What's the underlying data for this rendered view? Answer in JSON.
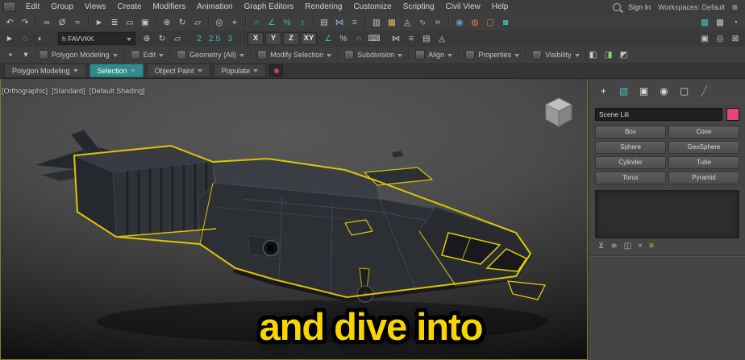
{
  "app": {
    "selection_color": "#e8cc00",
    "accent_color": "#3fbfbf"
  },
  "menubar": {
    "items": [
      "Edit",
      "Group",
      "Views",
      "Create",
      "Modifiers",
      "Animation",
      "Graph Editors",
      "Rendering",
      "Customize",
      "Scripting",
      "Civil View",
      "Help"
    ],
    "right": {
      "sign_in": "Sign In",
      "workspace": "Workspaces: Default",
      "menu_glyph": "≡"
    }
  },
  "toolbar1": {
    "icons": [
      {
        "name": "undo-icon",
        "glyph": "↶"
      },
      {
        "name": "redo-icon",
        "glyph": "↷"
      },
      {
        "name": "separator",
        "sep": true
      },
      {
        "name": "select-link-icon",
        "glyph": "∞"
      },
      {
        "name": "unlink-icon",
        "glyph": "Ø"
      },
      {
        "name": "bind-spacewarp-icon",
        "glyph": "≈"
      },
      {
        "name": "separator",
        "sep": true
      },
      {
        "name": "select-object-icon",
        "glyph": "►"
      },
      {
        "name": "select-by-name-icon",
        "glyph": "≣"
      },
      {
        "name": "rectangular-selection-icon",
        "glyph": "▭"
      },
      {
        "name": "window-crossing-icon",
        "glyph": "▣"
      },
      {
        "name": "separator",
        "sep": true
      },
      {
        "name": "select-move-icon",
        "glyph": "⊕"
      },
      {
        "name": "select-rotate-icon",
        "glyph": "↻"
      },
      {
        "name": "select-scale-icon",
        "glyph": "▱"
      },
      {
        "name": "separator",
        "sep": true
      },
      {
        "name": "use-pivot-center-icon",
        "glyph": "◎"
      },
      {
        "name": "select-manipulate-icon",
        "glyph": "⌖"
      },
      {
        "name": "separator",
        "sep": true
      },
      {
        "name": "snap-toggle-icon",
        "glyph": "∩",
        "color": "#3fbfbf"
      },
      {
        "name": "angle-snap-icon",
        "glyph": "∠",
        "color": "#3fbfbf"
      },
      {
        "name": "percent-snap-icon",
        "glyph": "%",
        "color": "#3fbfbf"
      },
      {
        "name": "spinner-snap-icon",
        "glyph": "↕",
        "color": "#3fbfbf"
      },
      {
        "name": "separator",
        "sep": true
      },
      {
        "name": "named-selection-icon",
        "glyph": "▤"
      },
      {
        "name": "mirror-icon",
        "glyph": "⋈",
        "color": "#8ab4d8"
      },
      {
        "name": "align-icon",
        "glyph": "≡",
        "color": "#8ab4d8"
      },
      {
        "name": "separator",
        "sep": true
      },
      {
        "name": "scene-explorer-icon",
        "glyph": "▥"
      },
      {
        "name": "layer-manager-icon",
        "glyph": "▦",
        "color": "#d8c05a"
      },
      {
        "name": "ribbon-toggle-icon",
        "glyph": "◬"
      },
      {
        "name": "curve-editor-icon",
        "glyph": "∿",
        "color": "#8fd06a"
      },
      {
        "name": "schematic-view-icon",
        "glyph": "⌗"
      },
      {
        "name": "separator",
        "sep": true
      },
      {
        "name": "material-editor-icon",
        "glyph": "◉",
        "color": "#5aa7e0"
      },
      {
        "name": "render-setup-icon",
        "glyph": "◍",
        "color": "#e0785a"
      },
      {
        "name": "rendered-frame-icon",
        "glyph": "▢",
        "color": "#e0785a"
      },
      {
        "name": "render-production-icon",
        "glyph": "◙",
        "color": "#3fbfbf"
      },
      {
        "name": "help-cube-icon",
        "glyph": "▩",
        "color": "#3fbfbf",
        "right": true
      },
      {
        "name": "grid-icon",
        "glyph": "▦"
      },
      {
        "name": "user-account-icon",
        "glyph": "◔"
      }
    ]
  },
  "toolbar2": {
    "icons_a": [
      {
        "name": "selection-mode-icon",
        "glyph": "►"
      },
      {
        "name": "lasso-selection-icon",
        "glyph": "◌"
      },
      {
        "name": "paint-selection-icon",
        "glyph": "◐"
      },
      {
        "name": "separator",
        "sep": true
      }
    ],
    "combo_value": "h FAVVKK",
    "icons_b": [
      {
        "name": "move-tool-icon",
        "glyph": "⊕"
      },
      {
        "name": "rotate-tool-icon",
        "glyph": "↻"
      },
      {
        "name": "scale-tool-icon",
        "glyph": "▱"
      },
      {
        "name": "separator",
        "sep": true
      },
      {
        "name": "snap-2d-icon",
        "glyph": "2",
        "color": "#3fbfbf"
      },
      {
        "name": "snap-25d-icon",
        "glyph": "2.5",
        "color": "#3fbfbf"
      },
      {
        "name": "snap-3d-icon",
        "glyph": "3",
        "color": "#3fbfbf"
      },
      {
        "name": "separator",
        "sep": true
      }
    ],
    "axis": [
      "X",
      "Y",
      "Z",
      "XY"
    ],
    "icons_c": [
      {
        "name": "angle-snap-toggle-icon",
        "glyph": "∠",
        "color": "#3fbfbf"
      },
      {
        "name": "percent-snap-toggle-icon",
        "glyph": "%"
      },
      {
        "name": "magnet-snap-icon",
        "glyph": "∩",
        "color": "#3fbfbf"
      },
      {
        "name": "keyboard-override-icon",
        "glyph": "⌨"
      },
      {
        "name": "separator",
        "sep": true
      },
      {
        "name": "mirror-tool-icon",
        "glyph": "⋈"
      },
      {
        "name": "align-tool-icon",
        "glyph": "≡"
      },
      {
        "name": "layers-icon",
        "glyph": "▤"
      },
      {
        "name": "graphite-tools-icon",
        "glyph": "◬"
      },
      {
        "name": "viewport-config-icon",
        "glyph": "▣",
        "right": true
      },
      {
        "name": "isolate-selection-icon",
        "glyph": "◎"
      },
      {
        "name": "lock-selection-icon",
        "glyph": "⊠"
      }
    ]
  },
  "ribbon": {
    "lead_icons": [
      {
        "name": "ribbon-show-panels-icon",
        "glyph": "▪"
      },
      {
        "name": "ribbon-minimize-icon",
        "glyph": "▾"
      }
    ],
    "groups": [
      {
        "label": "Polygon Modeling"
      },
      {
        "label": "Edit"
      },
      {
        "label": "Geometry (All)"
      },
      {
        "label": "Modify Selection"
      },
      {
        "label": "Subdivision"
      },
      {
        "label": "Align"
      },
      {
        "label": "Properties"
      },
      {
        "label": "Visibility"
      }
    ],
    "trail_icons": [
      {
        "name": "ribbon-display-icon",
        "glyph": "◧"
      },
      {
        "name": "ribbon-config-icon",
        "glyph": "◨",
        "color": "#8fd06a"
      },
      {
        "name": "ribbon-help-icon",
        "glyph": "◩"
      }
    ],
    "tabs": [
      {
        "label": "Polygon Modeling",
        "active": false
      },
      {
        "label": "Selection",
        "active": true
      },
      {
        "label": "Object Paint",
        "active": false
      },
      {
        "label": "Populate",
        "active": false
      }
    ]
  },
  "viewport": {
    "label_tokens": [
      "[Orthographic]",
      "[Standard]",
      "[Default Shading]"
    ],
    "caption": "and dive into"
  },
  "command_panel": {
    "tabs": [
      {
        "name": "create-tab-icon",
        "glyph": "+",
        "color": "#d8d8d8"
      },
      {
        "name": "modify-tab-icon",
        "glyph": "▧",
        "color": "#3fbfbf"
      },
      {
        "name": "hierarchy-tab-icon",
        "glyph": "▣",
        "color": "#d8d8d8"
      },
      {
        "name": "motion-tab-icon",
        "glyph": "◉",
        "color": "#d8d8d8"
      },
      {
        "name": "display-tab-icon",
        "glyph": "▢",
        "color": "#d8d8d8"
      },
      {
        "name": "utilities-tab-icon",
        "glyph": "╱",
        "color": "#e06a9a"
      }
    ],
    "object_name": "Scene Lili",
    "swatch_color": "#e8457d",
    "object_type_buttons": [
      {
        "label": "Box"
      },
      {
        "label": "Cone"
      },
      {
        "label": "Sphere"
      },
      {
        "label": "GeoSphere"
      },
      {
        "label": "Cylinder"
      },
      {
        "label": "Tube"
      },
      {
        "label": "Torus"
      },
      {
        "label": "Pyramid"
      }
    ],
    "stack_toolbar": [
      {
        "name": "pin-stack-icon",
        "glyph": "⊻"
      },
      {
        "name": "show-end-result-icon",
        "glyph": "≑"
      },
      {
        "name": "make-unique-icon",
        "glyph": "◫"
      },
      {
        "name": "remove-modifier-icon",
        "glyph": "×"
      },
      {
        "name": "configure-modifier-sets-icon",
        "glyph": "≡",
        "color": "#cfd400"
      }
    ]
  }
}
